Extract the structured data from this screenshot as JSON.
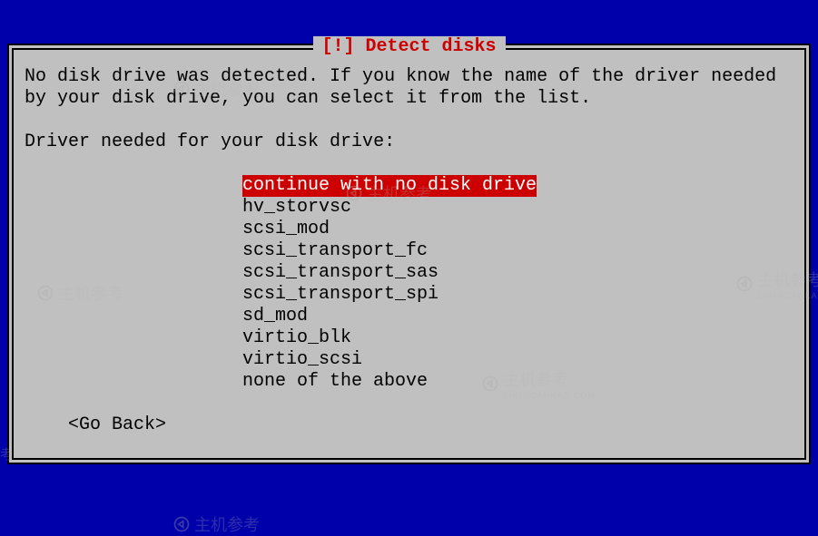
{
  "dialog": {
    "title": "[!] Detect disks",
    "message_line1": "No disk drive was detected. If you know the name of the driver needed",
    "message_line2": "by your disk drive, you can select it from the list.",
    "prompt": "Driver needed for your disk drive:",
    "drivers": {
      "0": "continue with no disk drive",
      "1": "hv_storvsc",
      "2": "scsi_mod",
      "3": "scsi_transport_fc",
      "4": "scsi_transport_sas",
      "5": "scsi_transport_spi",
      "6": "sd_mod",
      "7": "virtio_blk",
      "8": "virtio_scsi",
      "9": "none of the above"
    },
    "selected_index": 0,
    "go_back": "<Go Back>"
  },
  "watermark": {
    "text": "主机参考",
    "sub": "ZHUJICANKAO.COM"
  }
}
